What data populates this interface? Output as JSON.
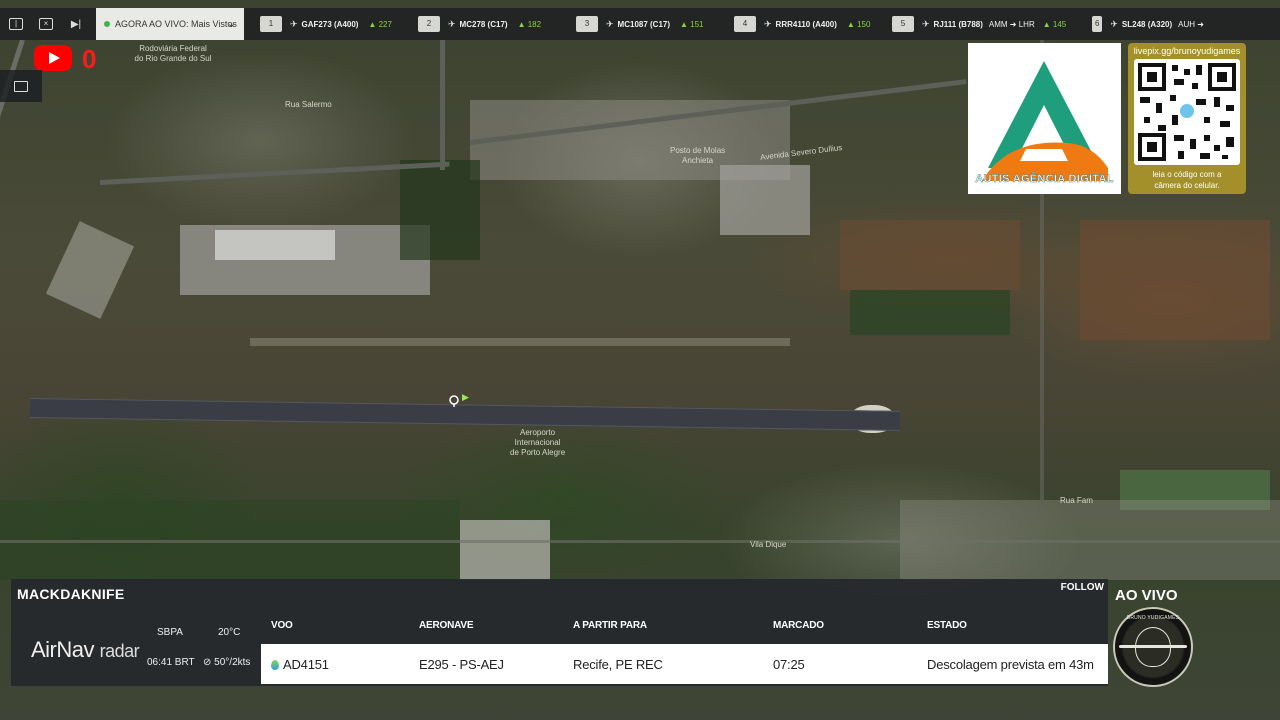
{
  "topbar": {
    "mode_label": "AGORA AO VIVO: Mais Vistos",
    "flights": [
      {
        "num": "1",
        "code": "GAF273 (A400)",
        "alt": "227",
        "route": ""
      },
      {
        "num": "2",
        "code": "MC278 (C17)",
        "alt": "182",
        "route": ""
      },
      {
        "num": "3",
        "code": "MC1087 (C17)",
        "alt": "151",
        "route": ""
      },
      {
        "num": "4",
        "code": "RRR4110 (A400)",
        "alt": "150",
        "route": ""
      },
      {
        "num": "5",
        "code": "RJ111 (B788)",
        "alt": "145",
        "route": "AMM ➜ LHR"
      },
      {
        "num": "6",
        "code": "SL248 (A320)",
        "alt": "",
        "route": "AUH ➜"
      }
    ]
  },
  "youtube": {
    "count": "0"
  },
  "map": {
    "labels": {
      "rodoviaria": "Rodoviária Federal\ndo Rio Grande do Sul",
      "rua_salermo": "Rua Salermo",
      "posto": "Posto de Molas\nAnchieta",
      "severo_dullius": "Avenida Severo Dullius",
      "airport": "Aeroporto\nInternacional\nde Porto Alegre",
      "vila_dique": "Vila Dique",
      "rua_fam": "Rua Fam"
    }
  },
  "logos": {
    "agency": "AUTIS AGÊNCIA DIGITAL",
    "qr_url": "livepix.gg/brunoyudigames",
    "qr_caption": "leia o código com a\ncâmera do celular."
  },
  "panel": {
    "callsign": "MACKDAKNIFE",
    "follow": "FOLLOW",
    "brand_main": "AirNav",
    "brand_sub": "radar",
    "airport": "SBPA",
    "time": "06:41 BRT",
    "temp": "20°C",
    "wind": "50°/2kts",
    "headers": {
      "voo": "VOO",
      "aeronave": "AERONAVE",
      "partir": "A PARTIR PARA",
      "marcado": "MARCADO",
      "estado": "ESTADO"
    },
    "row": {
      "voo": "AD4151",
      "aeronave": "E295 - PS-AEJ",
      "partir": "Recife, PE REC",
      "marcado": "07:25",
      "estado": "Descolagem prevista em 43m"
    }
  },
  "live": {
    "label": "AO VIVO",
    "badge_text": "BRUNO YUDIGAMES"
  }
}
